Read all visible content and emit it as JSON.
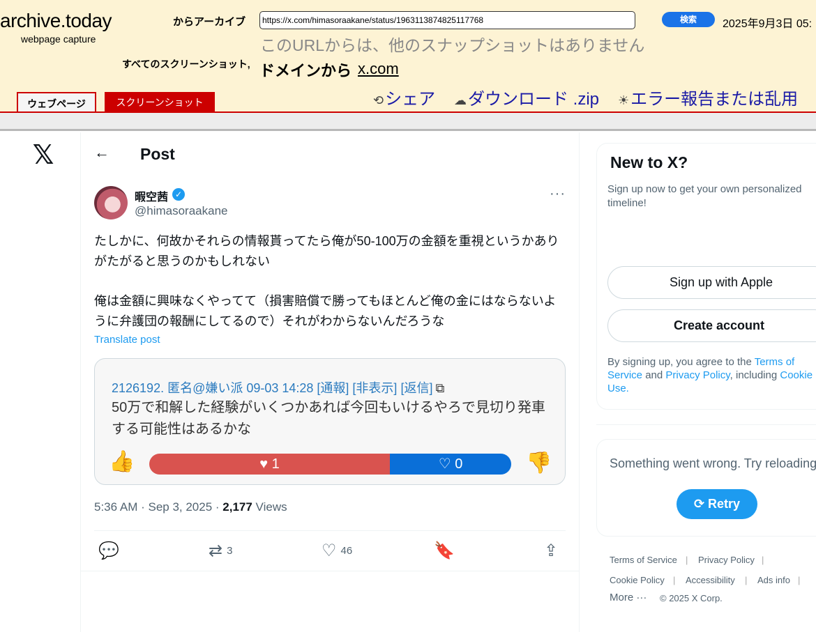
{
  "archive": {
    "logo": "archive.today",
    "logo_sub": "webpage capture",
    "archive_label": "からアーカイブ",
    "url_value": "https://x.com/himasoraakane/status/1963113874825117768",
    "search_label": "検索",
    "date": "2025年9月3日 05:",
    "no_snapshots": "このURLからは、他のスナップショットはありません",
    "all_screenshots_label": "すべてのスクリーンショット,",
    "domain_from": "ドメインから",
    "domain_link": "x.com",
    "tab_webpage": "ウェブページ",
    "tab_screenshot": "スクリーンショット",
    "share": "シェア",
    "download": "ダウンロード .zip",
    "report": "エラー報告または乱用"
  },
  "x": {
    "logo": "𝕏",
    "post_title": "Post",
    "author_name": "暇空茜",
    "author_handle": "@himasoraakane",
    "tweet_lines": [
      "たしかに、何故かそれらの情報貰ってたら俺が50-100万の金額を重視というかありがたがると思うのかもしれない",
      "俺は金額に興味なくやってて（損害賠償で勝ってもほとんど俺の金にはならないように弁護団の報酬にしてるので）それがわからないんだろうな"
    ],
    "translate": "Translate post",
    "card": {
      "header": "2126192. 匿名@嫌い派 09-03 14:28 [通報] [非表示] [返信]",
      "body": "50万で和解した経験がいくつかあれば今回もいけるやろで見切り発車する可能性はあるかな",
      "likes": "1",
      "dislikes": "0"
    },
    "time": "5:36 AM · Sep 3, 2025 · ",
    "views_count": "2,177",
    "views_label": " Views",
    "retweets": "3",
    "likes": "46"
  },
  "sidebar": {
    "new_title": "New to X?",
    "new_sub": "Sign up now to get your own personalized timeline!",
    "apple_btn": "Sign up with Apple",
    "create_btn": "Create account",
    "legal_1": "By signing up, you agree to the ",
    "legal_terms": "Terms of Service",
    "legal_2": " and ",
    "legal_privacy": "Privacy Policy",
    "legal_3": ", including ",
    "legal_cookie": "Cookie Use.",
    "error_text": "Something went wrong. Try reloading.",
    "retry": "Retry",
    "footer": {
      "terms": "Terms of Service",
      "privacy": "Privacy Policy",
      "cookie": "Cookie Policy",
      "accessibility": "Accessibility",
      "ads": "Ads info",
      "more": "More ···",
      "copyright": "© 2025 X Corp."
    }
  },
  "colors": {
    "archive_bg": "#fdf3d4",
    "archive_red": "#cc0000",
    "x_blue": "#1d9bf0"
  }
}
